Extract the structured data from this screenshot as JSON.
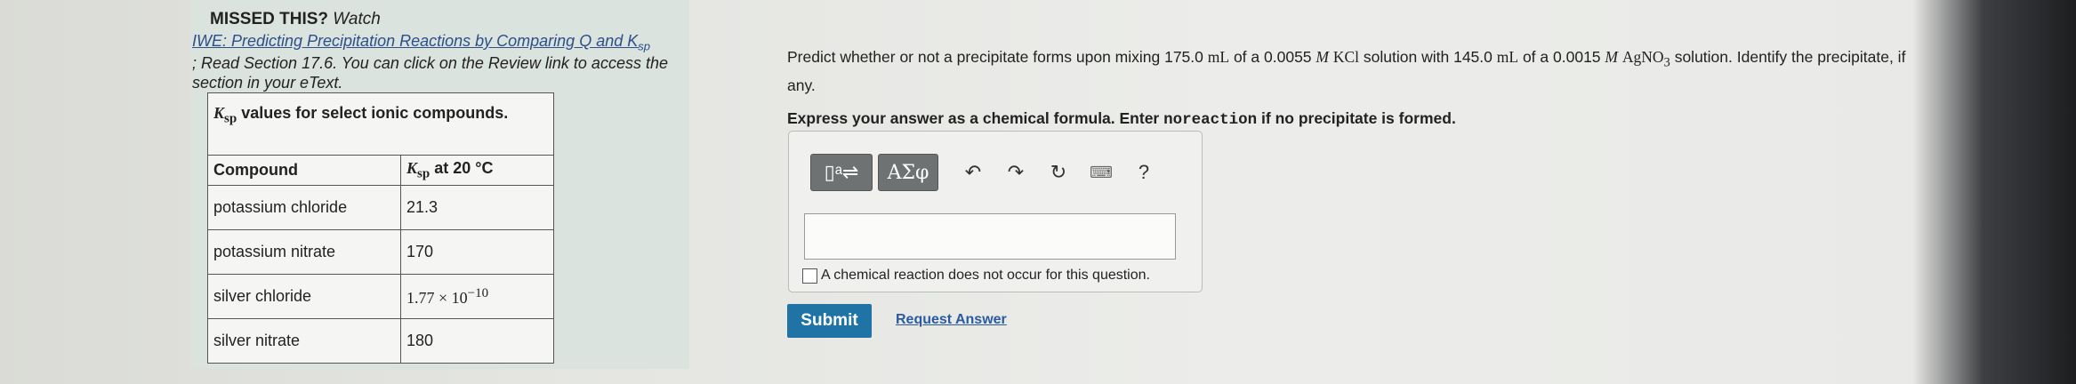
{
  "sidebar": {
    "missed_label": "MISSED THIS?",
    "watch_label": "Watch",
    "iwe_link_text": "IWE: Predicting Precipitation Reactions by Comparing Q and K",
    "iwe_link_sub": "sp",
    "read_text": "; Read Section 17.6. You can click on the Review link to access the section in your eText."
  },
  "ksp_table": {
    "caption_symbol": "K",
    "caption_sub": "sp",
    "caption_text": "values for select ionic compounds.",
    "header_compound": "Compound",
    "header_ksp_symbol": "K",
    "header_ksp_sub": "sp",
    "header_ksp_text": "at 20 °C",
    "rows": [
      {
        "compound": "potassium chloride",
        "ksp": "21.3"
      },
      {
        "compound": "potassium nitrate",
        "ksp": "170"
      },
      {
        "compound": "silver chloride",
        "ksp": "1.77 × 10",
        "ksp_exp": "−10"
      },
      {
        "compound": "silver nitrate",
        "ksp": "180"
      }
    ]
  },
  "question": {
    "text_pre": "Predict whether or not a precipitate forms upon mixing 175.0",
    "unit1": "mL",
    "text_mid1": "of a 0.0055",
    "conc1": "M",
    "salt1": "KCl",
    "text_mid2": "solution with 145.0",
    "unit2": "mL",
    "text_mid3": "of a 0.0015",
    "conc2": "M",
    "salt2_base": "AgNO",
    "salt2_sub": "3",
    "text_post": "solution. Identify the precipitate, if any."
  },
  "instruction": {
    "pre": "Express your answer as a chemical formula. Enter",
    "code": "noreaction",
    "post": "if no precipitate is formed."
  },
  "toolbar": {
    "templates_label": "▯ᵃ⇌",
    "greek_label": "ΑΣφ",
    "undo_label": "↶",
    "redo_label": "↷",
    "reset_label": "↻",
    "keyboard_label": "⌨",
    "help_label": "?"
  },
  "answer": {
    "input_value": "",
    "no_reaction_label": "A chemical reaction does not occur for this question."
  },
  "actions": {
    "submit_label": "Submit",
    "request_label": "Request Answer"
  }
}
